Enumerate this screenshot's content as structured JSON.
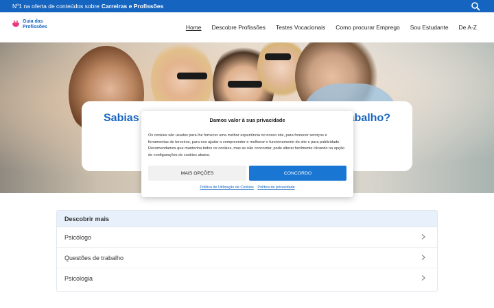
{
  "topbar": {
    "text": "Nº1 na oferta de conteúdos sobre",
    "bold": "Carreiras e Profissões"
  },
  "logo": {
    "line1": "Guia das",
    "line2": "Profissões"
  },
  "nav": {
    "items": [
      "Home",
      "Descobre Profissões",
      "Testes Vocacionais",
      "Como procurar Emprego",
      "Sou Estudante",
      "De A-Z"
    ]
  },
  "hero": {
    "title_start": "Sabias q",
    "title_end": "abalho?"
  },
  "cookie": {
    "title": "Damos valor à sua privacidade",
    "text": "Os cookies são usados para lhe fornecer uma melhor experiência no nosso site, para fornecer serviços e ferramentas de terceiros, para nos ajudar a compreender e melhorar o funcionamento do site e para publicidade. Recomendamos que mantenha todos os cookies, mas se não concordar, pode alterar facilmente clicando na opção de configurações de cookies abaixo.",
    "more_button": "MAIS OPÇÕES",
    "accept_button": "CONCORDO",
    "link_terms": "Política de Utilização de Cookies",
    "link_privacy": "Política de privacidade"
  },
  "discover": {
    "heading": "Descobrir mais",
    "items": [
      "Psicólogo",
      "Questões de trabalho",
      "Psicologia"
    ]
  },
  "colors": {
    "brand": "#1565c0",
    "accent": "#1976d2"
  },
  "icons": [
    "search-icon",
    "logo-icon",
    "chevron-right-icon"
  ]
}
